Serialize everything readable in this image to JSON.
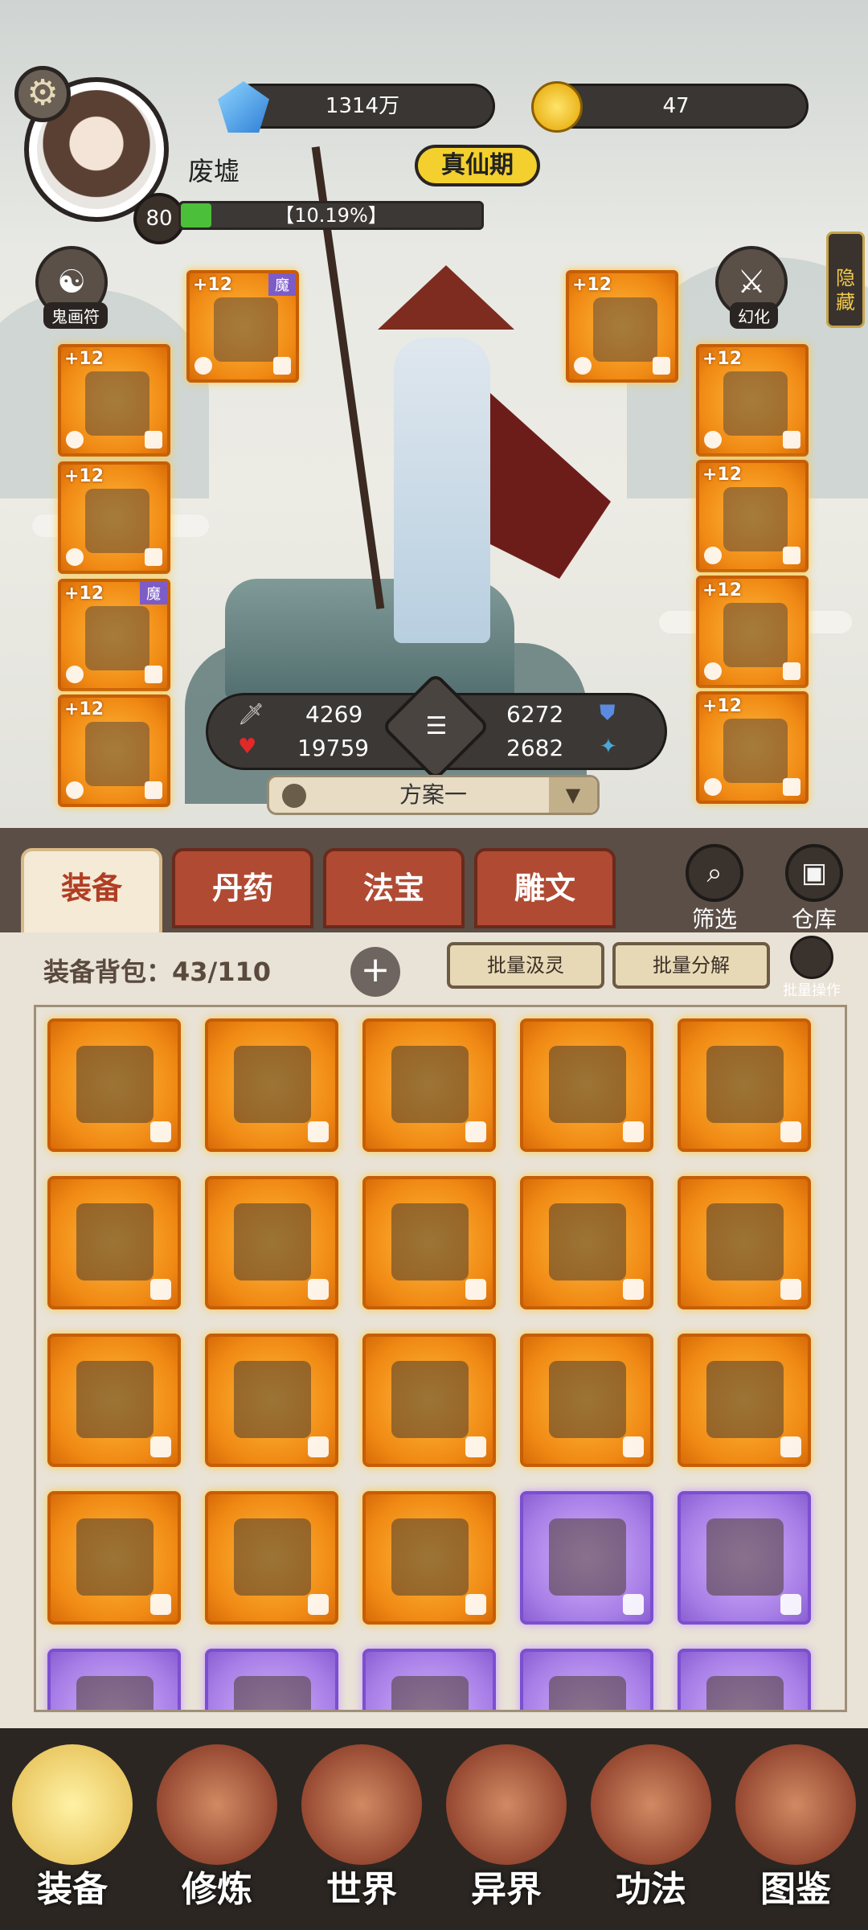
{
  "player": {
    "name": "废墟",
    "level": "80",
    "realm": "真仙期",
    "exp_percent_text": "【10.19%】",
    "exp_fraction": 0.1019
  },
  "resources": {
    "gems": "1314万",
    "coins": "47"
  },
  "side_buttons": {
    "ghost_talisman": "鬼画符",
    "transform": "幻化",
    "hide": "隐藏"
  },
  "equipped": {
    "left": [
      {
        "plus": "+12",
        "tag": ""
      },
      {
        "plus": "+12",
        "tag": ""
      },
      {
        "plus": "+12",
        "tag": "魔"
      },
      {
        "plus": "+12",
        "tag": ""
      }
    ],
    "top_left": {
      "plus": "+12",
      "tag": "魔"
    },
    "top_right": {
      "plus": "+12",
      "tag": ""
    },
    "right": [
      {
        "plus": "+12",
        "tag": ""
      },
      {
        "plus": "+12",
        "tag": ""
      },
      {
        "plus": "+12",
        "tag": ""
      },
      {
        "plus": "+12",
        "tag": ""
      }
    ]
  },
  "stats": {
    "attack": "4269",
    "hp": "19759",
    "defense": "6272",
    "speed": "2682"
  },
  "plan": "方案一",
  "tabs": [
    "装备",
    "丹药",
    "法宝",
    "雕文"
  ],
  "filter_label": "筛选",
  "warehouse_label": "仓库",
  "bag": {
    "title": "装备背包：43/110",
    "batch_absorb": "批量汲灵",
    "batch_decompose": "批量分解",
    "batch_op": "批量操作"
  },
  "items": [
    "orange",
    "orange",
    "orange",
    "orange",
    "orange",
    "orange",
    "orange",
    "orange",
    "orange",
    "orange",
    "orange",
    "orange",
    "orange",
    "orange",
    "orange",
    "orange",
    "orange",
    "orange",
    "purple",
    "purple",
    "purple",
    "purple",
    "purple",
    "purple",
    "purple"
  ],
  "nav": [
    "装备",
    "修炼",
    "世界",
    "异界",
    "功法",
    "图鉴"
  ]
}
